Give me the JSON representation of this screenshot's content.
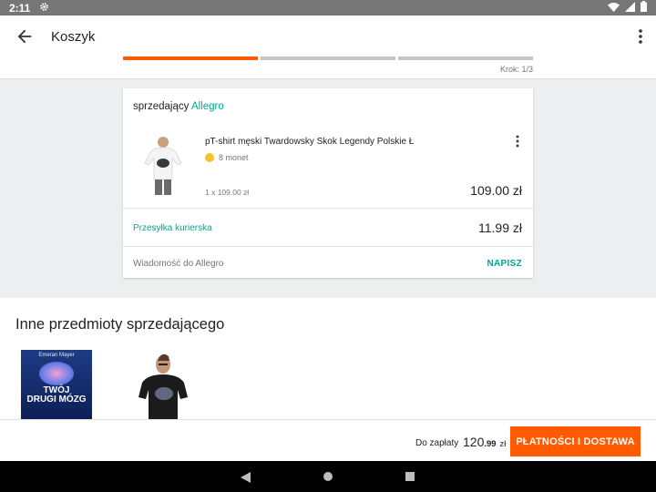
{
  "status_bar": {
    "time": "2:11"
  },
  "header": {
    "title": "Koszyk",
    "step_label": "Krok: 1/3",
    "steps_total": 3,
    "step_current": 1
  },
  "cart": {
    "seller_prefix": "sprzedający",
    "seller_name": "Allegro",
    "product": {
      "name": "pT-shirt męski Twardowsky Skok Legendy Polskie Ł",
      "coins": "8 monet",
      "unit_price": "1 x 109.00 zł",
      "price": "109.00 zł"
    },
    "shipping": {
      "label": "Przesyłka kurierska",
      "price": "11.99 zł"
    },
    "message": {
      "label": "Wiadomość do Allegro",
      "action": "NAPISZ"
    }
  },
  "other_items": {
    "title": "Inne przedmioty sprzedającego",
    "book": {
      "author": "Emeran Mayer",
      "title_line1": "TWÓJ",
      "title_line2": "DRUGI MÓZG"
    }
  },
  "footer": {
    "pay_label": "Do zapłaty",
    "amount_int": "120",
    "amount_frac": ".99",
    "currency": "zł",
    "button": "PŁATNOŚCI I DOSTAWA"
  },
  "colors": {
    "accent": "#ff5a00",
    "brand": "#00a790"
  }
}
